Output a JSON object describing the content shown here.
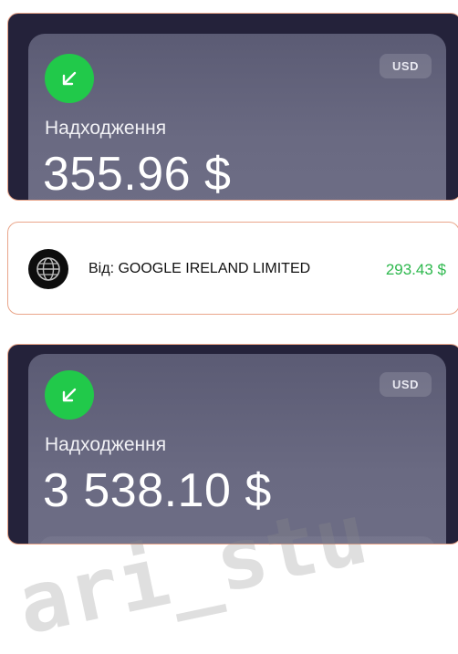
{
  "cards": [
    {
      "currency": "USD",
      "label": "Надходження",
      "amount": "355.96 $"
    },
    {
      "currency": "USD",
      "label": "Надходження",
      "amount": "3 538.10 $"
    }
  ],
  "transaction": {
    "text": "Від: GOOGLE IRELAND LIMITED",
    "amount": "293.43 $",
    "icon": "globe-icon"
  },
  "watermark": "ari_stu",
  "colors": {
    "income_green": "#21c94a",
    "amount_green": "#2db84d",
    "card_border": "#e9a58a",
    "card_bg": "#24223a"
  }
}
